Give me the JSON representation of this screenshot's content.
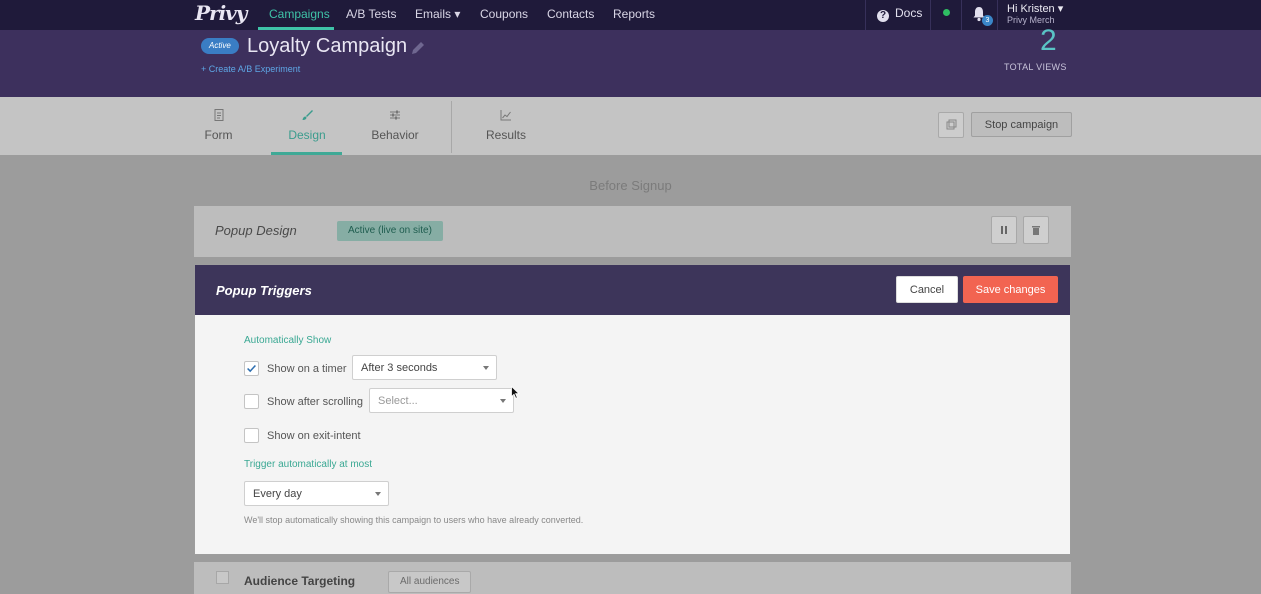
{
  "brand": {
    "logo_text": "Privy"
  },
  "nav": {
    "items": [
      {
        "label": "Campaigns",
        "active": true
      },
      {
        "label": "A/B Tests"
      },
      {
        "label": "Emails ▾"
      },
      {
        "label": "Coupons"
      },
      {
        "label": "Contacts"
      },
      {
        "label": "Reports"
      }
    ],
    "docs_label": "Docs",
    "notification_count": "3",
    "user_greeting": "Hi Kristen ▾",
    "user_org": "Privy Merch"
  },
  "campaign": {
    "status_badge": "Active",
    "title": "Loyalty Campaign",
    "ab_link": "+ Create A/B Experiment",
    "total_views": "2",
    "total_views_label": "TOTAL VIEWS"
  },
  "tabs": [
    {
      "label": "Form",
      "icon": "form-icon"
    },
    {
      "label": "Design",
      "icon": "brush-icon",
      "active": true
    },
    {
      "label": "Behavior",
      "icon": "sliders-icon"
    },
    {
      "label": "Results",
      "icon": "chart-icon"
    }
  ],
  "toolbar": {
    "stop_label": "Stop campaign"
  },
  "section_heading": "Before Signup",
  "popup_design": {
    "title": "Popup Design",
    "status": "Active (live on site)"
  },
  "triggers": {
    "title": "Popup Triggers",
    "cancel_label": "Cancel",
    "save_label": "Save changes",
    "auto_show_label": "Automatically Show",
    "timer": {
      "label": "Show on a timer",
      "checked": true,
      "value": "After 3 seconds"
    },
    "scrolling": {
      "label": "Show after scrolling",
      "checked": false,
      "placeholder": "Select..."
    },
    "exit_intent": {
      "label": "Show on exit-intent",
      "checked": false
    },
    "frequency_label": "Trigger automatically at most",
    "frequency_value": "Every day",
    "hint": "We'll stop automatically showing this campaign to users who have already converted."
  },
  "audience": {
    "title": "Audience Targeting",
    "badge": "All audiences"
  },
  "colors": {
    "accent": "#3fc3a8",
    "save": "#f26451",
    "header": "#3d305d",
    "nav": "#1f1a3a"
  }
}
